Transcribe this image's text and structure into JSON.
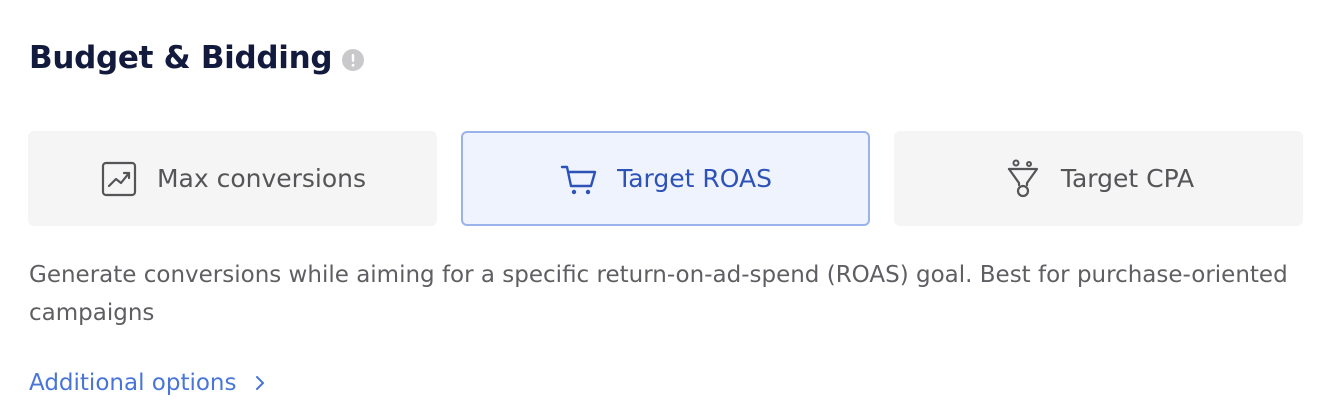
{
  "section": {
    "title": "Budget & Bidding",
    "info_icon": "info-icon"
  },
  "bidding_options": [
    {
      "label": "Max conversions",
      "icon": "trending-chart-icon",
      "selected": false
    },
    {
      "label": "Target ROAS",
      "icon": "shopping-cart-icon",
      "selected": true
    },
    {
      "label": "Target CPA",
      "icon": "target-funnel-icon",
      "selected": false
    }
  ],
  "description": "Generate conversions while aiming for a specific return-on-ad-spend (ROAS) goal. Best for purchase-oriented campaigns",
  "additional_options": {
    "label": "Additional options",
    "icon": "chevron-right-icon"
  },
  "colors": {
    "title": "#121a3e",
    "selected_border": "#9bb3ea",
    "selected_bg": "#eef3fd",
    "selected_text": "#2d52b8",
    "link": "#4a75d8"
  }
}
